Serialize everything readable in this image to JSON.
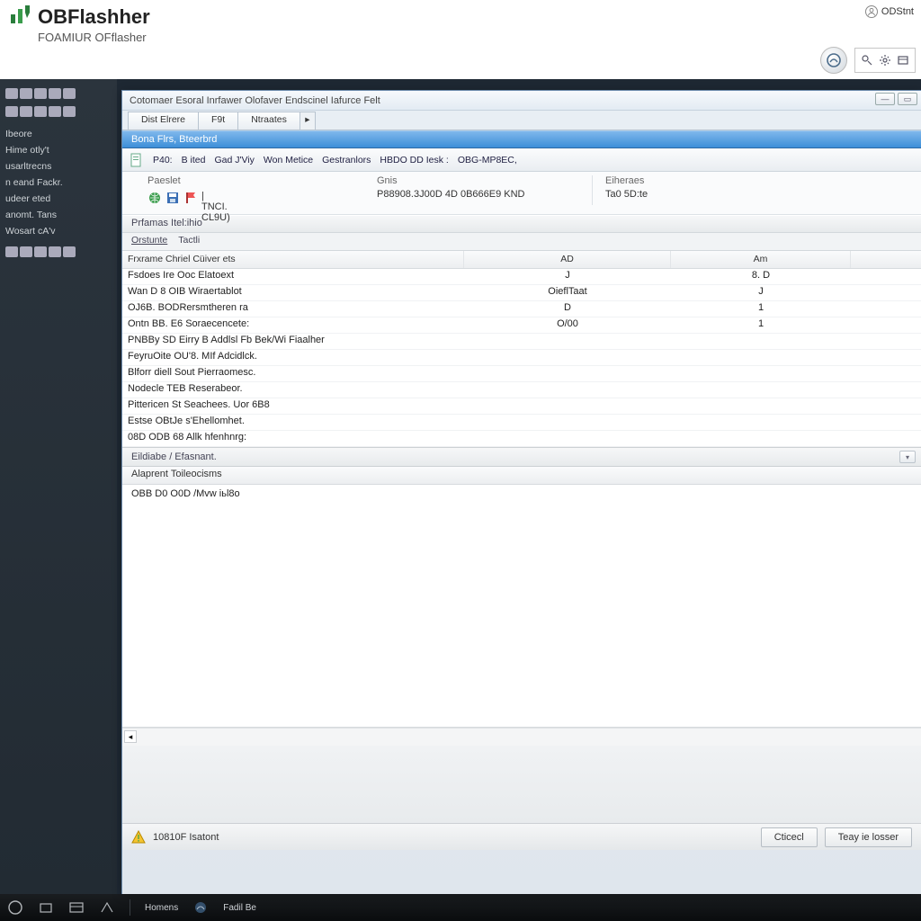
{
  "header": {
    "logo_text": "OBFlashher",
    "logo_sub": "FOAMIUR OFflasher",
    "user_label": "ODStnt"
  },
  "sidebar": {
    "items": [
      "Ibeore",
      "Hime otly't",
      "usarltrecns",
      "n eand Fackr.",
      "udeer eted",
      "anomt. Tans",
      "Wosart cA'v"
    ]
  },
  "window": {
    "title": "Cotomaer Esoral Inrfawer Olofaver Endscinel Iafurce Felt",
    "tabs": [
      "Dist Elrere",
      "F9t",
      "Ntraates"
    ],
    "bluebar": "Bona  Flrs, Bteerbrd",
    "toolbar_items": [
      "P40:",
      "B ited",
      "Gad J'Viy",
      "Won Metice",
      "Gestranlors",
      "HBDO  DD  Iesk  :",
      "OBG-MP8EC,"
    ],
    "info": {
      "col1_label": "Paeslet",
      "col1_value": "|  TNCI. CL9U)",
      "col2_label": "Gnis",
      "col2_value": "P88908.3J00D 4D 0B666E9 KND",
      "col3_label": "Eiheraes",
      "col3_value": "Ta0 5D:te"
    },
    "section1": "Prfamas   Itel:ihio",
    "subtabs": [
      "Orstunte",
      "Tactli"
    ],
    "table": {
      "headers": [
        "Frxrame Chriel Cüiver ets",
        "AD",
        "Am"
      ],
      "rows": [
        [
          "Fsdoes Ire Ooc Elatoext",
          "J",
          "8. D"
        ],
        [
          "Wan D 8 OIB Wiraertablot",
          "OieflTaat",
          "J"
        ],
        [
          "OJ6B. BODRersmtheren ra",
          "D",
          "1"
        ],
        [
          "Ontn BB. E6 Soraecencete:",
          "O/00",
          "1"
        ],
        [
          "PNBBy SD Eirry B Addlsl Fb Bek/Wi Fiaalher",
          "",
          ""
        ],
        [
          "FeyruOite OU'8. MIf Adcidlck.",
          "",
          ""
        ],
        [
          "Blforr diell Sout Pierraomesc.",
          "",
          ""
        ],
        [
          "Nodecle TEB Reserabeor.",
          "",
          ""
        ],
        [
          "Pittericen St Seachees. Uor 6B8",
          "",
          ""
        ],
        [
          "Estse OBtJe s'Ehellomhet.",
          "",
          ""
        ],
        [
          "08D ODB 68 Allk hfenhnrg:",
          "",
          ""
        ]
      ]
    },
    "divider": "Eildiabe / Efasnant.",
    "log_header": "Alaprent Toileocisms",
    "log_line": "OBB D0 O0D /Mvw iьl8o",
    "status_text": "10810F Isatont",
    "btn_cancel": "Cticecl",
    "btn_apply": "Teay ie losser"
  },
  "taskbar": {
    "label1": "Homens",
    "label2": "Fadil Be"
  }
}
